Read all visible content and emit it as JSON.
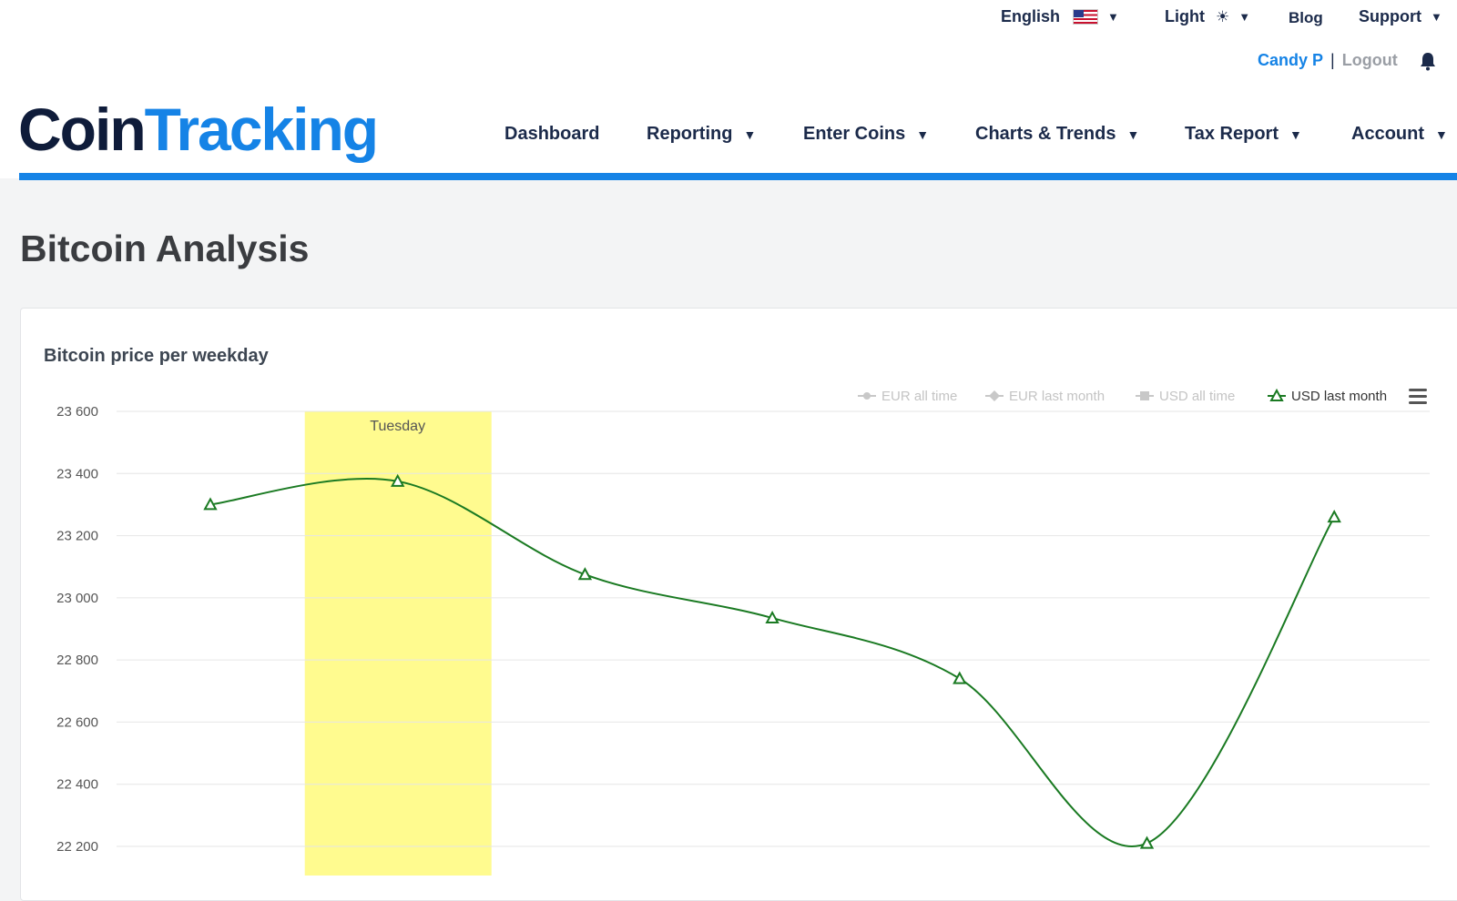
{
  "header": {
    "language": "English",
    "theme": "Light",
    "blog": "Blog",
    "support": "Support",
    "user_name": "Candy P",
    "separator": "|",
    "logout": "Logout",
    "logo_part1": "Coin",
    "logo_part2": "Tracking"
  },
  "nav": {
    "dashboard": "Dashboard",
    "reporting": "Reporting",
    "enter_coins": "Enter Coins",
    "charts_trends": "Charts & Trends",
    "tax_report": "Tax Report",
    "account": "Account"
  },
  "page": {
    "title": "Bitcoin Analysis"
  },
  "colors": {
    "brand_blue": "#1583e6",
    "series_green": "#1a7a22",
    "highlight_yellow": "#fffb8f"
  },
  "chart_data": {
    "type": "line",
    "title": "Bitcoin price per weekday",
    "categories": [
      "",
      "Tuesday",
      "",
      "",
      "",
      "",
      ""
    ],
    "highlighted_category": "Tuesday",
    "ylim": [
      22200,
      23600
    ],
    "y_ticks": [
      "23 600",
      "23 400",
      "23 200",
      "23 000",
      "22 800",
      "22 600",
      "22 400",
      "22 200"
    ],
    "legend_placement": "top-right",
    "legend": [
      {
        "name": "EUR all time",
        "visible": false,
        "marker": "circle"
      },
      {
        "name": "EUR last month",
        "visible": false,
        "marker": "diamond"
      },
      {
        "name": "USD all time",
        "visible": false,
        "marker": "square"
      },
      {
        "name": "USD last month",
        "visible": true,
        "marker": "triangle"
      }
    ],
    "series": [
      {
        "name": "USD last month",
        "values": [
          23300,
          23375,
          23075,
          22935,
          22740,
          22210,
          23260
        ]
      }
    ],
    "grid": true
  }
}
